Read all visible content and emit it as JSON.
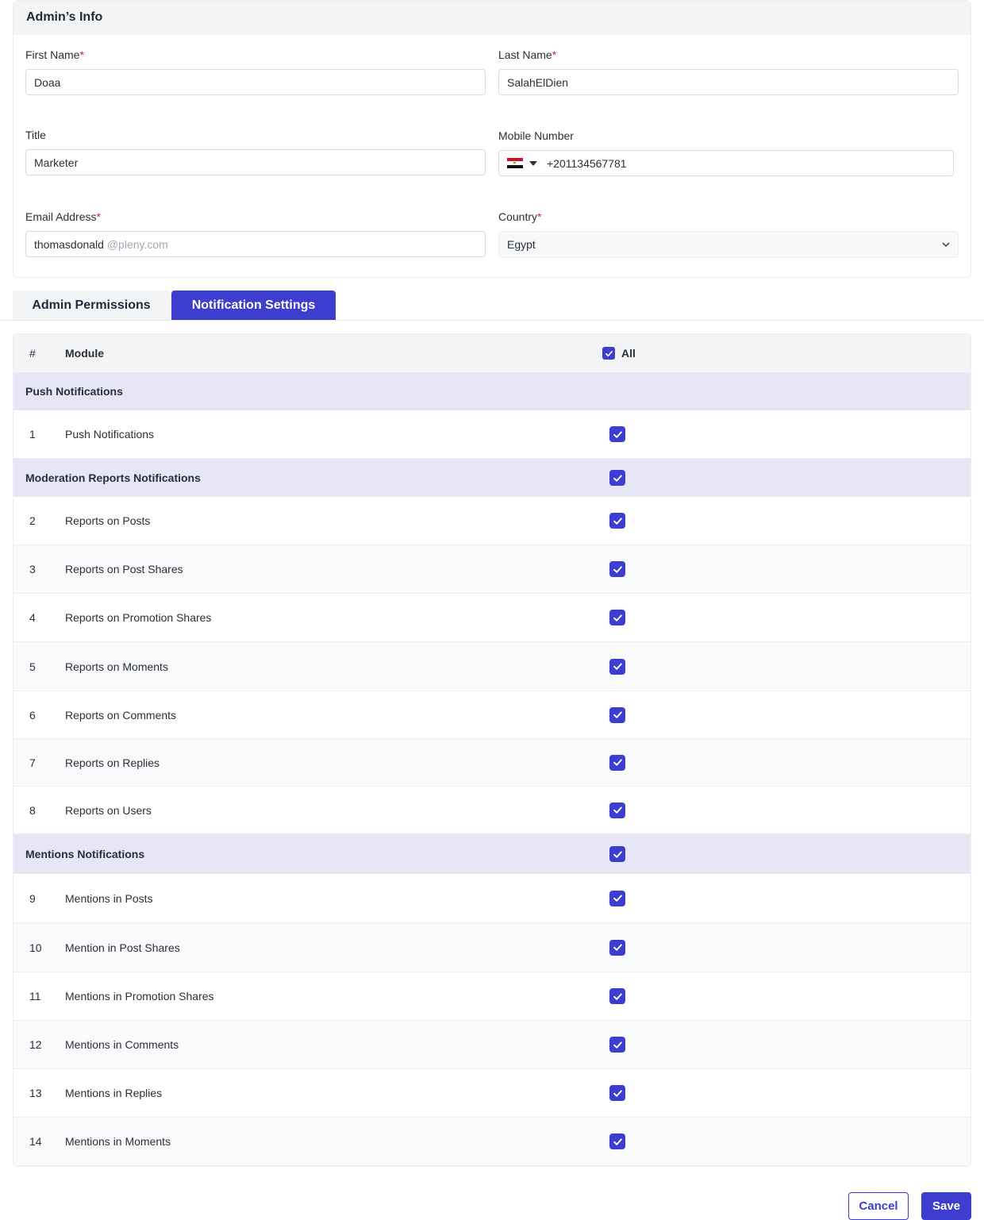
{
  "admin_info": {
    "title": "Admin’s Info",
    "first_name": {
      "label": "First Name",
      "required": "*",
      "value": "Doaa"
    },
    "last_name": {
      "label": "Last Name",
      "required": "*",
      "value": "SalahElDien"
    },
    "job_title": {
      "label": "Title",
      "value": "Marketer"
    },
    "mobile": {
      "label": "Mobile Number",
      "value": "+201134567781",
      "flag_icon": "egypt-flag-icon"
    },
    "email": {
      "label": "Email Address",
      "required": "*",
      "value": "thomasdonald",
      "domain_suffix": "@pleny.com"
    },
    "country": {
      "label": "Country",
      "required": "*",
      "value": "Egypt"
    }
  },
  "tabs": [
    {
      "label": "Admin Permissions",
      "active": false
    },
    {
      "label": "Notification Settings",
      "active": true
    }
  ],
  "table": {
    "header": {
      "num": "#",
      "module": "Module",
      "all_label": "All",
      "all_checked": true
    },
    "groups": [
      {
        "title": "Push Notifications",
        "has_checkbox": false,
        "items": [
          {
            "num": "1",
            "module": "Push Notifications",
            "checked": true
          }
        ]
      },
      {
        "title": "Moderation Reports Notifications",
        "has_checkbox": true,
        "items": [
          {
            "num": "2",
            "module": "Reports on Posts",
            "checked": true
          },
          {
            "num": "3",
            "module": "Reports on Post Shares",
            "checked": true
          },
          {
            "num": "4",
            "module": "Reports on Promotion Shares",
            "checked": true
          },
          {
            "num": "5",
            "module": "Reports on Moments",
            "checked": true
          },
          {
            "num": "6",
            "module": "Reports on Comments",
            "checked": true
          },
          {
            "num": "7",
            "module": "Reports on Replies",
            "checked": true
          },
          {
            "num": "8",
            "module": "Reports on Users",
            "checked": true
          }
        ]
      },
      {
        "title": "Mentions Notifications",
        "has_checkbox": true,
        "items": [
          {
            "num": "9",
            "module": "Mentions in Posts",
            "checked": true
          },
          {
            "num": "10",
            "module": "Mention in Post Shares",
            "checked": true
          },
          {
            "num": "11",
            "module": "Mentions in Promotion Shares",
            "checked": true
          },
          {
            "num": "12",
            "module": "Mentions in Comments",
            "checked": true
          },
          {
            "num": "13",
            "module": "Mentions in Replies",
            "checked": true
          },
          {
            "num": "14",
            "module": "Mentions in Moments",
            "checked": true
          }
        ]
      }
    ]
  },
  "footer": {
    "cancel_label": "Cancel",
    "save_label": "Save"
  },
  "colors": {
    "accent": "#3d3dd0",
    "group_bg": "#e6e6f7",
    "required": "#d81b3a"
  }
}
